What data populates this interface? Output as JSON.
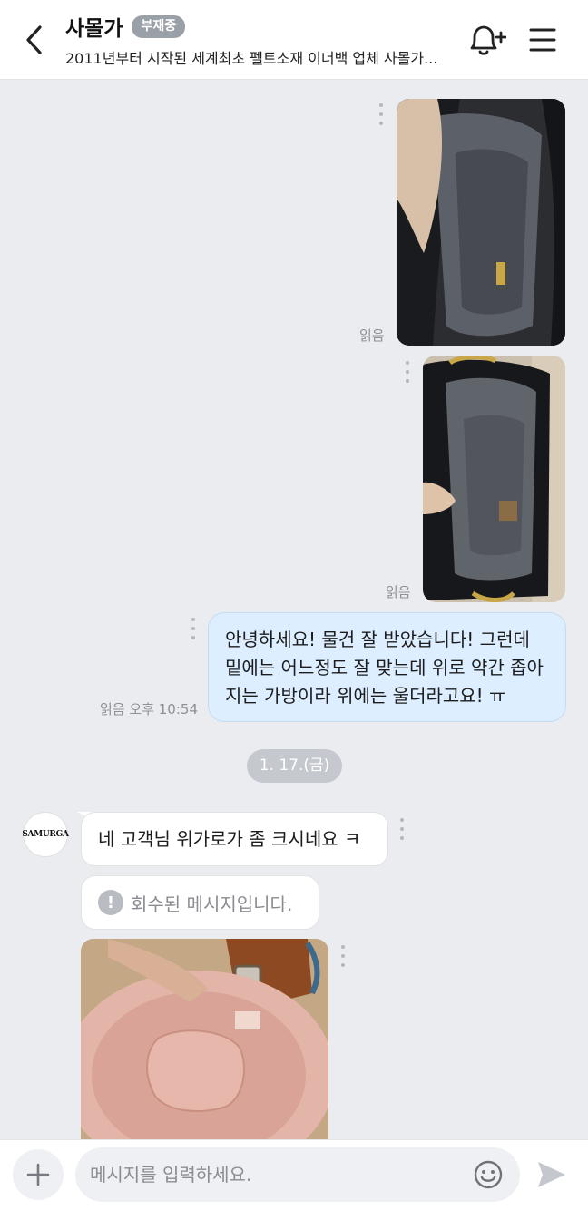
{
  "header": {
    "title": "사몰가",
    "status_badge": "부재중",
    "subtitle": "2011년부터 시작된 세계최초 펠트소재 이너백 업체 사몰가...",
    "icons": [
      "back-arrow-icon",
      "bell-plus-icon",
      "hamburger-menu-icon"
    ]
  },
  "messages": {
    "photo1": {
      "read_label": "읽음"
    },
    "photo2": {
      "read_label": "읽음"
    },
    "outgoing_text": "안녕하세요! 물건 잘 받았습니다! 그런데 밑에는 어느정도 잘 맞는데 위로 약간 좁아지는 가방이라 위에는 울더라고요! ㅠ",
    "outgoing_read": "읽음",
    "outgoing_time": "오후 10:54",
    "date_separator": "1. 17.(금)",
    "avatar_text": "SAMURGA",
    "incoming_text": "네 고객님 위가로가 좀 크시네요 ㅋ",
    "recalled_icon": "!",
    "recalled_text": "회수된 메시지입니다."
  },
  "input": {
    "placeholder": "메시지를 입력하세요.",
    "value": "",
    "icons": [
      "plus-icon",
      "emoji-icon",
      "send-icon"
    ]
  },
  "colors": {
    "background": "#ebecf0",
    "outgoing_bubble": "#dceeff",
    "incoming_bubble": "#ffffff",
    "badge": "#9aa0a8"
  }
}
